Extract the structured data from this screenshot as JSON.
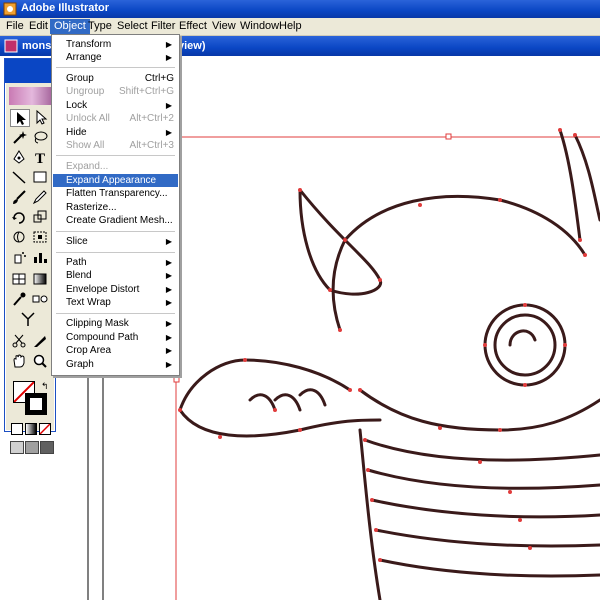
{
  "app": {
    "title": "Adobe Illustrator"
  },
  "menubar": {
    "items": [
      "File",
      "Edit",
      "Object",
      "Type",
      "Select",
      "Filter",
      "Effect",
      "View",
      "Window",
      "Help"
    ],
    "active": "Object"
  },
  "document": {
    "title_left": "mons",
    "title_right": "view)"
  },
  "object_menu": {
    "transform": "Transform",
    "arrange": "Arrange",
    "group": "Group",
    "group_sc": "Ctrl+G",
    "ungroup": "Ungroup",
    "ungroup_sc": "Shift+Ctrl+G",
    "lock": "Lock",
    "unlock_all": "Unlock All",
    "unlock_all_sc": "Alt+Ctrl+2",
    "hide": "Hide",
    "show_all": "Show All",
    "show_all_sc": "Alt+Ctrl+3",
    "expand": "Expand...",
    "expand_appearance": "Expand Appearance",
    "flatten_transparency": "Flatten Transparency...",
    "rasterize": "Rasterize...",
    "create_gradient_mesh": "Create Gradient Mesh...",
    "slice": "Slice",
    "path": "Path",
    "blend": "Blend",
    "envelope_distort": "Envelope Distort",
    "text_wrap": "Text Wrap",
    "clipping_mask": "Clipping Mask",
    "compound_path": "Compound Path",
    "crop_area": "Crop Area",
    "graph": "Graph"
  },
  "colors": {
    "accent": "#316ac5",
    "selection": "#e03c3c",
    "xp_blue": "#0a46c4"
  }
}
